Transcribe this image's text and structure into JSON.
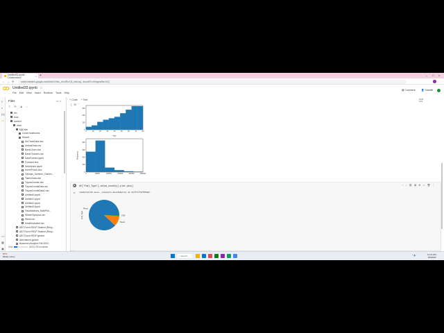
{
  "browser": {
    "tab_title": "Untitled33.ipynb - Colaboratory",
    "url": "colab.research.google.com/drive/1VnhL_eb-xfRrz7j3_ecbLwg...#scrollTo=tfXwgew9ec1XQ",
    "new_tab": "+",
    "close": "×",
    "back": "←",
    "forward": "→",
    "reload": "⟳",
    "win_min": "–",
    "win_max": "□",
    "win_close": "×"
  },
  "colab": {
    "logo": "CO",
    "notebook_title": "Untitled33.ipynb",
    "star": "☆",
    "menu": [
      "File",
      "Edit",
      "View",
      "Insert",
      "Runtime",
      "Tools",
      "Help"
    ],
    "comment": "Comment",
    "share": "Share",
    "settings_icon": "⚙"
  },
  "files_panel": {
    "title": "Files",
    "tree": [
      {
        "label": "bin",
        "kind": "folder",
        "depth": 1
      },
      {
        "label": "boot",
        "kind": "folder",
        "depth": 1
      },
      {
        "label": "content",
        "kind": "folder",
        "depth": 1
      },
      {
        "label": "drive",
        "kind": "folder",
        "depth": 2
      },
      {
        "label": "MyDrive",
        "kind": "folder",
        "depth": 3
      },
      {
        "label": "Colab Notebooks",
        "kind": "folder",
        "depth": 4
      },
      {
        "label": "Wizard",
        "kind": "folder",
        "depth": 4
      },
      {
        "label": "AmTrackData.xlsx",
        "kind": "file",
        "depth": 5
      },
      {
        "label": "AmtrakData.csv",
        "kind": "file",
        "depth": 5
      },
      {
        "label": "BankChurn.xlsx",
        "kind": "file",
        "depth": 5
      },
      {
        "label": "BankChurners.csv",
        "kind": "file",
        "depth": 5
      },
      {
        "label": "DataFrames.ipynb",
        "kind": "file",
        "depth": 5
      },
      {
        "label": "Forecast.xlsx",
        "kind": "file",
        "depth": 5
      },
      {
        "label": "HelloWorld.ipynb",
        "kind": "file",
        "depth": 5
      },
      {
        "label": "HomePrices.xlsx",
        "kind": "file",
        "depth": 5
      },
      {
        "label": "Olympic_Summer_Games...",
        "kind": "file",
        "depth": 5
      },
      {
        "label": "TitanicData.xlsx",
        "kind": "file",
        "depth": 5
      },
      {
        "label": "ToyotaCorolla.xlsx",
        "kind": "file",
        "depth": 5
      },
      {
        "label": "ToyotaCorollaData.csv",
        "kind": "file",
        "depth": 5
      },
      {
        "label": "ToyotaCorollaData2.csv",
        "kind": "file",
        "depth": 5
      },
      {
        "label": "Untitled0.ipynb",
        "kind": "file",
        "depth": 5
      },
      {
        "label": "Untitled1.ipynb",
        "kind": "file",
        "depth": 5
      },
      {
        "label": "Untitled2.ipynb",
        "kind": "file",
        "depth": 5
      },
      {
        "label": "Untitled3.ipynb",
        "kind": "file",
        "depth": 5
      },
      {
        "label": "Visualizations_MultiPlot...",
        "kind": "file",
        "depth": 5
      },
      {
        "label": "WinterOlympics.csv",
        "kind": "file",
        "depth": 5
      },
      {
        "label": "Week.csv",
        "kind": "file",
        "depth": 5
      },
      {
        "label": "ModulesAdded.csv",
        "kind": "file",
        "depth": 5
      },
      {
        "label": "ABT Event RSVP Student (Resp...",
        "kind": "file",
        "depth": 3
      },
      {
        "label": "ABT Event RSVP Student (Resp...",
        "kind": "file",
        "depth": 3
      },
      {
        "label": "ABT Event RSVP.gsheet",
        "kind": "file",
        "depth": 3
      },
      {
        "label": "Attendance.gsheet",
        "kind": "file",
        "depth": 3
      },
      {
        "label": "Business Analytics Fall 2022...",
        "kind": "file",
        "depth": 3
      }
    ],
    "disk_label": "Disk",
    "disk_text": "58.51 GB available",
    "disk_used_fraction": 0.25
  },
  "notebook": {
    "toolbar_code": "+ Code",
    "toolbar_text": "+ Text",
    "ram_label": "RAM",
    "disk_label": "Disk",
    "cell1_number": "[ 30 ]",
    "cell2_code": "df['Fuel_Type'].value_counts().plot.pie()",
    "cell2_output": "<matplotlib.axes._subplots.AxesSubplot at 0x7f7cf17575d0>",
    "next_cell": "[ ]"
  },
  "chart_data": [
    {
      "type": "bar",
      "xlabel": "Age",
      "ylabel": "",
      "categories": [
        "0-8",
        "8-16",
        "16-24",
        "24-32",
        "32-40",
        "40-48",
        "48-56",
        "56-64",
        "64-72",
        "72-80"
      ],
      "values": [
        40,
        60,
        110,
        140,
        160,
        180,
        230,
        280,
        330,
        330
      ],
      "ylim": [
        0,
        340
      ],
      "xticks": [
        "0",
        "10",
        "20",
        "30",
        "40",
        "50",
        "60",
        "70",
        "80"
      ],
      "yticks": [
        "0",
        "100",
        "200",
        "300"
      ]
    },
    {
      "type": "bar",
      "xlabel": "",
      "ylabel": "Frequency",
      "categories": [
        "0-40000",
        "40000-80000",
        "80000-120000",
        "120000-160000",
        "160000-200000",
        "200000-240000"
      ],
      "values": [
        550,
        850,
        120,
        50,
        20,
        10
      ],
      "ylim": [
        0,
        900
      ],
      "xticks": [
        "0",
        "50000",
        "100000",
        "150000",
        "200000",
        "250000"
      ],
      "yticks": [
        "0",
        "200",
        "400",
        "600",
        "800"
      ]
    },
    {
      "type": "pie",
      "ylabel": "Fuel_Type",
      "slices": [
        {
          "label": "Petrol",
          "value": 1264,
          "color": "#1f77b4"
        },
        {
          "label": "Diesel",
          "value": 155,
          "color": "#ff7f0e"
        },
        {
          "label": "CNG",
          "value": 17,
          "color": "#2ca02c"
        }
      ]
    }
  ],
  "statusbar": {
    "check": "✓",
    "text": "0s   completed at 11:14 AM",
    "close": "×"
  },
  "taskbar": {
    "weather_temp": "57°F",
    "weather_text": "Mostly sunny",
    "search_placeholder": "Search",
    "tray_text": "^  🔊",
    "time": "11:14 AM",
    "date": "3/9/2023",
    "app_colors": [
      "#f0b400",
      "#0078d4",
      "#e74856",
      "#107c10",
      "#8e24aa",
      "#0f9d58",
      "#4285f4"
    ]
  },
  "colors": {
    "accent": "#f9ab00",
    "bar": "#1f77b4",
    "primary": "#1a73e8"
  }
}
